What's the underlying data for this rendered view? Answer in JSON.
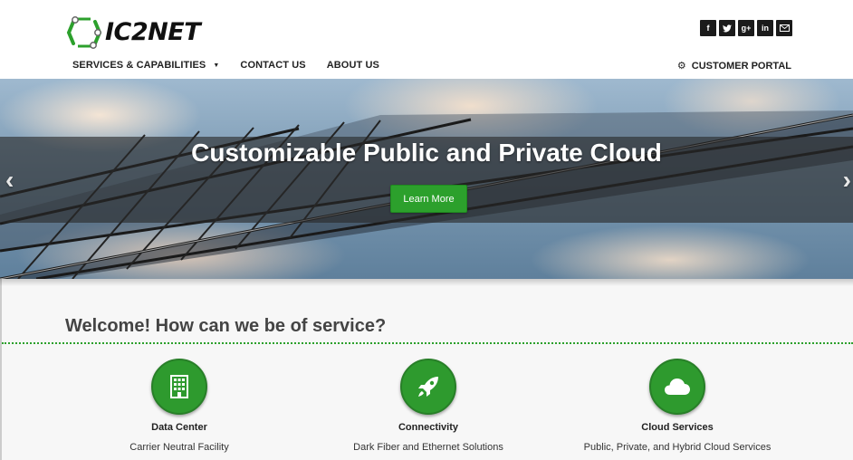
{
  "brand": {
    "name": "IC2NET",
    "accent": "#2ca02c"
  },
  "social": [
    {
      "icon": "facebook-icon",
      "glyph": "f"
    },
    {
      "icon": "twitter-icon",
      "glyph": "t"
    },
    {
      "icon": "google-plus-icon",
      "glyph": "g+"
    },
    {
      "icon": "linkedin-icon",
      "glyph": "in"
    },
    {
      "icon": "email-icon",
      "glyph": "✉"
    }
  ],
  "nav": {
    "services_label": "SERVICES & CAPABILITIES",
    "contact_label": "CONTACT US",
    "about_label": "ABOUT US",
    "portal_label": "CUSTOMER PORTAL",
    "portal_icon": "gear-icon"
  },
  "hero": {
    "title": "Customizable Public and Private Cloud",
    "button_label": "Learn More",
    "prev_glyph": "‹",
    "next_glyph": "›"
  },
  "welcome": {
    "heading": "Welcome! How can we be of service?"
  },
  "services": [
    {
      "icon": "building-icon",
      "title": "Data Center",
      "description": "Carrier Neutral Facility"
    },
    {
      "icon": "rocket-icon",
      "title": "Connectivity",
      "description": "Dark Fiber and Ethernet Solutions"
    },
    {
      "icon": "cloud-icon",
      "title": "Cloud Services",
      "description": "Public, Private, and Hybrid Cloud Services"
    }
  ]
}
